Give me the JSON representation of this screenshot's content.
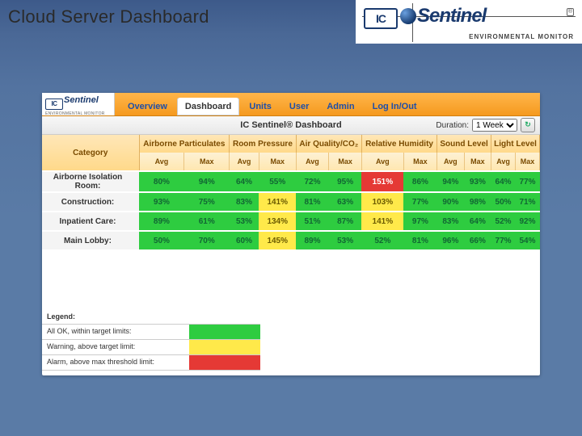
{
  "page_title": "Cloud Server Dashboard",
  "brand": {
    "ic": "IC",
    "sentinel": "Sentinel",
    "tagline": "ENVIRONMENTAL MONITOR",
    "registered": "®"
  },
  "mini_brand": {
    "ic": "IC",
    "sentinel": "Sentinel",
    "sub": "ENVIRONMENTAL MONITOR"
  },
  "tabs": [
    {
      "label": "Overview",
      "active": false
    },
    {
      "label": "Dashboard",
      "active": true
    },
    {
      "label": "Units",
      "active": false
    },
    {
      "label": "User",
      "active": false
    },
    {
      "label": "Admin",
      "active": false
    },
    {
      "label": "Log In/Out",
      "active": false
    }
  ],
  "dashboard_title": "IC Sentinel® Dashboard",
  "duration_label": "Duration:",
  "duration_value": "1 Week",
  "category_header": "Category",
  "metric_groups": [
    "Airborne Particulates",
    "Room Pressure",
    "Air Quality/CO₂",
    "Relative Humidity",
    "Sound Level",
    "Light Level"
  ],
  "sub_headers": [
    "Avg",
    "Max"
  ],
  "rows": [
    {
      "label": "Airborne Isolation Room:",
      "cells": [
        {
          "v": "80%",
          "c": "g"
        },
        {
          "v": "94%",
          "c": "g"
        },
        {
          "v": "64%",
          "c": "g"
        },
        {
          "v": "55%",
          "c": "g"
        },
        {
          "v": "72%",
          "c": "g"
        },
        {
          "v": "95%",
          "c": "g"
        },
        {
          "v": "151%",
          "c": "r"
        },
        {
          "v": "86%",
          "c": "g"
        },
        {
          "v": "94%",
          "c": "g"
        },
        {
          "v": "93%",
          "c": "g"
        },
        {
          "v": "64%",
          "c": "g"
        },
        {
          "v": "77%",
          "c": "g"
        }
      ]
    },
    {
      "label": "Construction:",
      "cells": [
        {
          "v": "93%",
          "c": "g"
        },
        {
          "v": "75%",
          "c": "g"
        },
        {
          "v": "83%",
          "c": "g"
        },
        {
          "v": "141%",
          "c": "y"
        },
        {
          "v": "81%",
          "c": "g"
        },
        {
          "v": "63%",
          "c": "g"
        },
        {
          "v": "103%",
          "c": "y"
        },
        {
          "v": "77%",
          "c": "g"
        },
        {
          "v": "90%",
          "c": "g"
        },
        {
          "v": "98%",
          "c": "g"
        },
        {
          "v": "50%",
          "c": "g"
        },
        {
          "v": "71%",
          "c": "g"
        }
      ]
    },
    {
      "label": "Inpatient Care:",
      "cells": [
        {
          "v": "89%",
          "c": "g"
        },
        {
          "v": "61%",
          "c": "g"
        },
        {
          "v": "53%",
          "c": "g"
        },
        {
          "v": "134%",
          "c": "y"
        },
        {
          "v": "51%",
          "c": "g"
        },
        {
          "v": "87%",
          "c": "g"
        },
        {
          "v": "141%",
          "c": "y"
        },
        {
          "v": "97%",
          "c": "g"
        },
        {
          "v": "83%",
          "c": "g"
        },
        {
          "v": "64%",
          "c": "g"
        },
        {
          "v": "52%",
          "c": "g"
        },
        {
          "v": "92%",
          "c": "g"
        }
      ]
    },
    {
      "label": "Main Lobby:",
      "cells": [
        {
          "v": "50%",
          "c": "g"
        },
        {
          "v": "70%",
          "c": "g"
        },
        {
          "v": "60%",
          "c": "g"
        },
        {
          "v": "145%",
          "c": "y"
        },
        {
          "v": "89%",
          "c": "g"
        },
        {
          "v": "53%",
          "c": "g"
        },
        {
          "v": "52%",
          "c": "g"
        },
        {
          "v": "81%",
          "c": "g"
        },
        {
          "v": "96%",
          "c": "g"
        },
        {
          "v": "66%",
          "c": "g"
        },
        {
          "v": "77%",
          "c": "g"
        },
        {
          "v": "54%",
          "c": "g"
        }
      ]
    }
  ],
  "legend": {
    "title": "Legend:",
    "items": [
      {
        "text": "All OK, within target limits:",
        "class": "g"
      },
      {
        "text": "Warning, above target limit:",
        "class": "y"
      },
      {
        "text": "Alarm, above max threshold limit:",
        "class": "r"
      }
    ]
  },
  "chart_data": {
    "type": "table",
    "title": "IC Sentinel® Dashboard",
    "columns": [
      "Airborne Particulates Avg",
      "Airborne Particulates Max",
      "Room Pressure Avg",
      "Room Pressure Max",
      "Air Quality/CO₂ Avg",
      "Air Quality/CO₂ Max",
      "Relative Humidity Avg",
      "Relative Humidity Max",
      "Sound Level Avg",
      "Sound Level Max",
      "Light Level Avg",
      "Light Level Max"
    ],
    "rows": {
      "Airborne Isolation Room": [
        80,
        94,
        64,
        55,
        72,
        95,
        151,
        86,
        94,
        93,
        64,
        77
      ],
      "Construction": [
        93,
        75,
        83,
        141,
        81,
        63,
        103,
        77,
        90,
        98,
        50,
        71
      ],
      "Inpatient Care": [
        89,
        61,
        53,
        134,
        51,
        87,
        141,
        97,
        83,
        64,
        52,
        92
      ],
      "Main Lobby": [
        50,
        70,
        60,
        145,
        89,
        53,
        52,
        81,
        96,
        66,
        77,
        54
      ]
    },
    "status_legend": {
      "g": "ok",
      "y": "warning",
      "r": "alarm"
    }
  }
}
